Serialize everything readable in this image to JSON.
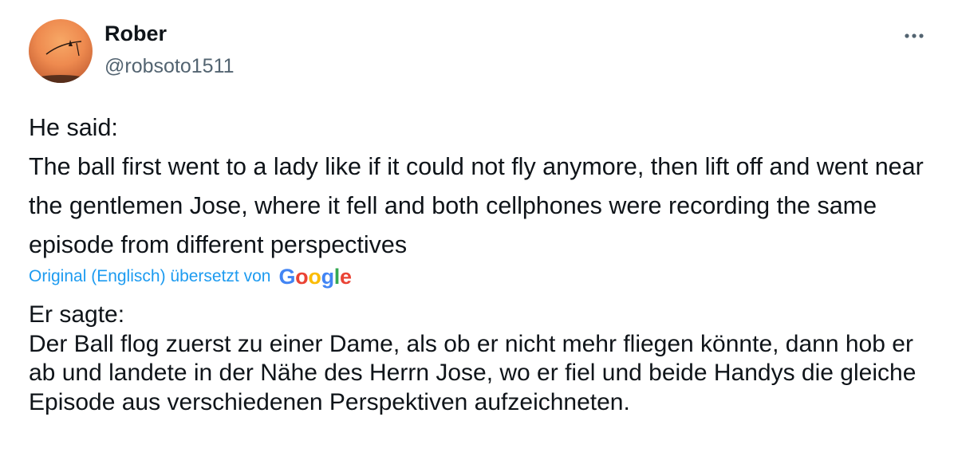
{
  "tweet": {
    "author_name": "Rober",
    "author_handle": "@robsoto1511",
    "more_icon": "more-horizontal-icon",
    "original_text": "He said:\nThe ball first went to a lady like if it could not fly anymore, then lift off and went near the gentlemen Jose, where it fell and both cellphones were recording the same episode from different perspectives",
    "translation_label": "Original (Englisch) übersetzt von",
    "translation_provider": "Google",
    "translated_text": "Er sagte:\nDer Ball flog zuerst zu einer Dame, als ob er nicht mehr fliegen könnte, dann hob er ab und landete in der Nähe des Herrn Jose, wo er fiel und beide Handys die gleiche Episode aus verschiedenen Perspektiven aufzeichneten."
  },
  "colors": {
    "text": "#0f1419",
    "secondary_text": "#536471",
    "link": "#1d9bf0",
    "google_blue": "#4285F4",
    "google_red": "#EA4335",
    "google_yellow": "#FBBC05",
    "google_green": "#34A853"
  }
}
